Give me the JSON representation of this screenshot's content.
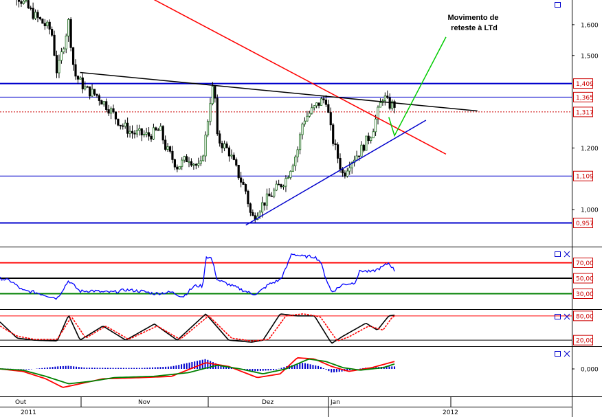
{
  "chart_data": [
    {
      "type": "candlestick",
      "annotation": "Movimento de\nreteste à LTd",
      "ylim": [
        0.88,
        1.68
      ],
      "yticks": [
        "1,600",
        "1,500",
        "1,200",
        "1,000"
      ],
      "levels": [
        {
          "label": "1,409",
          "value": 1.409,
          "color": "#0000cc"
        },
        {
          "label": "1,365",
          "value": 1.365,
          "color": "#0000cc"
        },
        {
          "label": "1,317",
          "value": 1.317,
          "color": "#cc0000"
        },
        {
          "label": "1,109",
          "value": 1.109,
          "color": "#0000cc"
        },
        {
          "label": "0,957",
          "value": 0.957,
          "color": "#0000cc"
        }
      ],
      "trendlines": [
        {
          "name": "LTd",
          "color": "#ff0000",
          "from": [
            0.23,
            1.72
          ],
          "to": [
            0.78,
            1.18
          ]
        },
        {
          "name": "resistance",
          "color": "#000000",
          "from": [
            0.14,
            1.445
          ],
          "to": [
            0.835,
            1.32
          ]
        },
        {
          "name": "LTa",
          "color": "#0000cc",
          "from": [
            0.43,
            0.95
          ],
          "to": [
            0.745,
            1.29
          ]
        }
      ],
      "projection": {
        "color": "#00cc00",
        "points": [
          [
            0.68,
            1.3
          ],
          [
            0.69,
            1.24
          ],
          [
            0.78,
            1.56
          ]
        ]
      },
      "close_path": [
        [
          0,
          1.76
        ],
        [
          0.06,
          1.63
        ],
        [
          0.09,
          1.58
        ],
        [
          0.1,
          1.44
        ],
        [
          0.12,
          1.61
        ],
        [
          0.13,
          1.44
        ],
        [
          0.15,
          1.39
        ],
        [
          0.17,
          1.37
        ],
        [
          0.19,
          1.33
        ],
        [
          0.21,
          1.28
        ],
        [
          0.23,
          1.25
        ],
        [
          0.26,
          1.24
        ],
        [
          0.28,
          1.26
        ],
        [
          0.29,
          1.2
        ],
        [
          0.31,
          1.14
        ],
        [
          0.33,
          1.17
        ],
        [
          0.35,
          1.13
        ],
        [
          0.36,
          1.24
        ],
        [
          0.37,
          1.39
        ],
        [
          0.375,
          1.39
        ],
        [
          0.38,
          1.23
        ],
        [
          0.4,
          1.19
        ],
        [
          0.42,
          1.1
        ],
        [
          0.43,
          1.06
        ],
        [
          0.44,
          0.97
        ],
        [
          0.46,
          1.02
        ],
        [
          0.48,
          1.06
        ],
        [
          0.5,
          1.1
        ],
        [
          0.52,
          1.19
        ],
        [
          0.53,
          1.29
        ],
        [
          0.55,
          1.33
        ],
        [
          0.56,
          1.35
        ],
        [
          0.57,
          1.36
        ],
        [
          0.58,
          1.24
        ],
        [
          0.6,
          1.11
        ],
        [
          0.61,
          1.15
        ],
        [
          0.63,
          1.19
        ],
        [
          0.64,
          1.22
        ],
        [
          0.65,
          1.25
        ],
        [
          0.67,
          1.37
        ],
        [
          0.68,
          1.34
        ]
      ]
    },
    {
      "type": "line",
      "name": "RSI",
      "ylim": [
        10,
        90
      ],
      "levels": [
        {
          "label": "70,00",
          "value": 70,
          "color": "#ff0000"
        },
        {
          "label": "50,00",
          "value": 50,
          "color": "#000000"
        },
        {
          "label": "30,00",
          "value": 30,
          "color": "#008000"
        }
      ],
      "values": [
        [
          0,
          50
        ],
        [
          0.02,
          46
        ],
        [
          0.04,
          34
        ],
        [
          0.06,
          32
        ],
        [
          0.08,
          28
        ],
        [
          0.1,
          24
        ],
        [
          0.12,
          47
        ],
        [
          0.14,
          33
        ],
        [
          0.16,
          34
        ],
        [
          0.18,
          32
        ],
        [
          0.2,
          32
        ],
        [
          0.22,
          35
        ],
        [
          0.25,
          33
        ],
        [
          0.27,
          30
        ],
        [
          0.3,
          32
        ],
        [
          0.32,
          26
        ],
        [
          0.34,
          40
        ],
        [
          0.355,
          40
        ],
        [
          0.36,
          78
        ],
        [
          0.37,
          76
        ],
        [
          0.38,
          48
        ],
        [
          0.4,
          42
        ],
        [
          0.42,
          36
        ],
        [
          0.44,
          30
        ],
        [
          0.45,
          30
        ],
        [
          0.47,
          42
        ],
        [
          0.49,
          48
        ],
        [
          0.5,
          62
        ],
        [
          0.51,
          82
        ],
        [
          0.53,
          78
        ],
        [
          0.55,
          78
        ],
        [
          0.56,
          72
        ],
        [
          0.57,
          50
        ],
        [
          0.58,
          32
        ],
        [
          0.6,
          42
        ],
        [
          0.62,
          44
        ],
        [
          0.63,
          60
        ],
        [
          0.65,
          58
        ],
        [
          0.67,
          65
        ],
        [
          0.68,
          70
        ],
        [
          0.69,
          60
        ]
      ]
    },
    {
      "type": "line",
      "name": "Stochastic",
      "ylim": [
        5,
        95
      ],
      "levels": [
        {
          "label": "80,00",
          "value": 80,
          "color": "#ff0000"
        },
        {
          "label": "20,00",
          "value": 20,
          "color": "#000000"
        }
      ],
      "series": [
        {
          "color": "#000000",
          "values": [
            [
              0,
              65
            ],
            [
              0.03,
              25
            ],
            [
              0.06,
              20
            ],
            [
              0.1,
              18
            ],
            [
              0.12,
              82
            ],
            [
              0.14,
              20
            ],
            [
              0.18,
              55
            ],
            [
              0.22,
              20
            ],
            [
              0.27,
              60
            ],
            [
              0.31,
              20
            ],
            [
              0.36,
              85
            ],
            [
              0.4,
              20
            ],
            [
              0.44,
              15
            ],
            [
              0.46,
              20
            ],
            [
              0.49,
              85
            ],
            [
              0.52,
              80
            ],
            [
              0.55,
              80
            ],
            [
              0.58,
              12
            ],
            [
              0.6,
              30
            ],
            [
              0.64,
              62
            ],
            [
              0.66,
              45
            ],
            [
              0.68,
              80
            ],
            [
              0.69,
              82
            ]
          ]
        },
        {
          "color": "#ff0000",
          "values": [
            [
              0,
              55
            ],
            [
              0.03,
              30
            ],
            [
              0.06,
              22
            ],
            [
              0.1,
              22
            ],
            [
              0.125,
              78
            ],
            [
              0.15,
              25
            ],
            [
              0.185,
              55
            ],
            [
              0.225,
              22
            ],
            [
              0.275,
              55
            ],
            [
              0.315,
              22
            ],
            [
              0.365,
              80
            ],
            [
              0.405,
              25
            ],
            [
              0.44,
              18
            ],
            [
              0.47,
              22
            ],
            [
              0.5,
              80
            ],
            [
              0.53,
              85
            ],
            [
              0.56,
              78
            ],
            [
              0.59,
              18
            ],
            [
              0.61,
              28
            ],
            [
              0.645,
              55
            ],
            [
              0.67,
              45
            ],
            [
              0.685,
              75
            ],
            [
              0.69,
              80
            ]
          ]
        }
      ]
    },
    {
      "type": "bar+line",
      "name": "MACD",
      "yticks": [
        "0,000"
      ],
      "ylim": [
        -0.2,
        0.2
      ],
      "histogram": [
        [
          0,
          0.005
        ],
        [
          0.05,
          -0.005
        ],
        [
          0.1,
          0.02
        ],
        [
          0.12,
          0.025
        ],
        [
          0.15,
          0.01
        ],
        [
          0.2,
          0.008
        ],
        [
          0.25,
          0.008
        ],
        [
          0.3,
          0.02
        ],
        [
          0.36,
          0.08
        ],
        [
          0.38,
          0.04
        ],
        [
          0.4,
          0.02
        ],
        [
          0.44,
          -0.02
        ],
        [
          0.48,
          -0.01
        ],
        [
          0.5,
          0.02
        ],
        [
          0.53,
          0.05
        ],
        [
          0.56,
          0.02
        ],
        [
          0.58,
          -0.03
        ],
        [
          0.6,
          -0.02
        ],
        [
          0.64,
          0.01
        ],
        [
          0.68,
          0.02
        ]
      ],
      "series": [
        {
          "color": "#ff0000",
          "values": [
            [
              0,
              0
            ],
            [
              0.04,
              -0.02
            ],
            [
              0.08,
              -0.08
            ],
            [
              0.11,
              -0.15
            ],
            [
              0.14,
              -0.12
            ],
            [
              0.18,
              -0.08
            ],
            [
              0.25,
              -0.07
            ],
            [
              0.3,
              -0.06
            ],
            [
              0.36,
              0.05
            ],
            [
              0.4,
              0.02
            ],
            [
              0.45,
              -0.07
            ],
            [
              0.49,
              -0.04
            ],
            [
              0.52,
              0.09
            ],
            [
              0.55,
              0.08
            ],
            [
              0.58,
              0.02
            ],
            [
              0.61,
              -0.02
            ],
            [
              0.65,
              0.01
            ],
            [
              0.69,
              0.06
            ]
          ]
        },
        {
          "color": "#008000",
          "values": [
            [
              0,
              0
            ],
            [
              0.04,
              -0.01
            ],
            [
              0.08,
              -0.06
            ],
            [
              0.12,
              -0.12
            ],
            [
              0.16,
              -0.1
            ],
            [
              0.2,
              -0.07
            ],
            [
              0.27,
              -0.06
            ],
            [
              0.33,
              -0.03
            ],
            [
              0.38,
              0.03
            ],
            [
              0.42,
              0.0
            ],
            [
              0.46,
              -0.04
            ],
            [
              0.5,
              0.0
            ],
            [
              0.54,
              0.08
            ],
            [
              0.57,
              0.06
            ],
            [
              0.6,
              0.01
            ],
            [
              0.63,
              -0.01
            ],
            [
              0.67,
              0.01
            ],
            [
              0.69,
              0.04
            ]
          ]
        }
      ]
    }
  ],
  "x_axis": {
    "months": [
      "Out",
      "Nov",
      "Dez",
      "Jan"
    ],
    "years": [
      "2011",
      "2012"
    ]
  },
  "colors": {
    "background": "#ffffff",
    "candle_up": "#1a6b1a",
    "candle_down": "#000000",
    "level_box_border": "#cc0000",
    "level_text": "#cc0000",
    "rsi_line": "#0000ff",
    "histogram": "#0000cc"
  }
}
